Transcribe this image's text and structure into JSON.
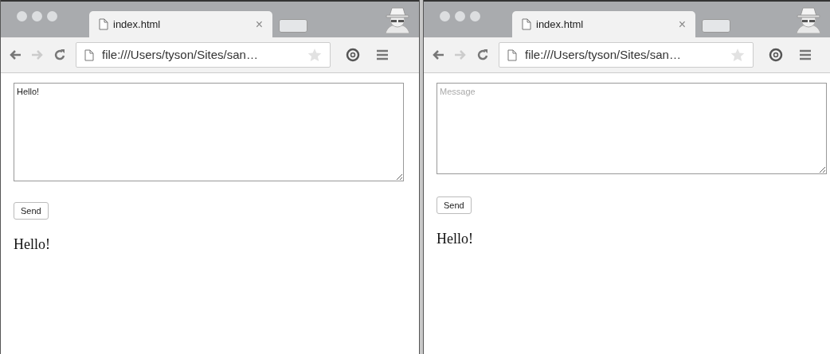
{
  "windows": [
    {
      "tab": {
        "title": "index.html",
        "close": "×"
      },
      "url": "file:///Users/tyson/Sites/san…",
      "message": {
        "value": "Hello!"
      },
      "button": "Send",
      "output": "Hello!"
    },
    {
      "tab": {
        "title": "index.html",
        "close": "×"
      },
      "url": "file:///Users/tyson/Sites/san…",
      "message": {
        "placeholder": "Message"
      },
      "button": "Send",
      "output": "Hello!"
    }
  ]
}
